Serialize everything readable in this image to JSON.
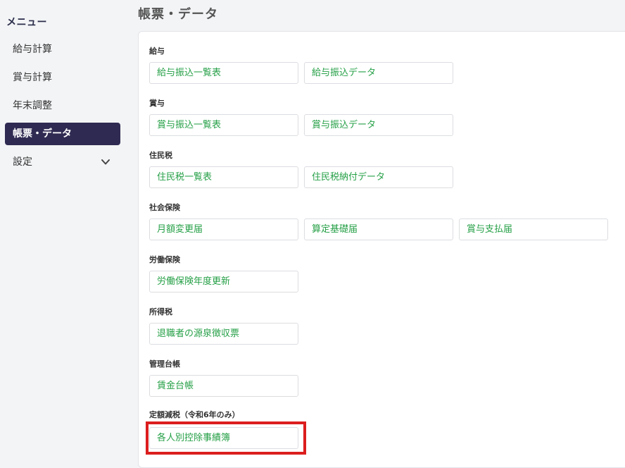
{
  "sidebar": {
    "heading": "メニュー",
    "items": [
      {
        "label": "給与計算"
      },
      {
        "label": "賞与計算"
      },
      {
        "label": "年末調整"
      },
      {
        "label": "帳票・データ"
      },
      {
        "label": "設定"
      }
    ],
    "active_item": "帳票・データ"
  },
  "header": {
    "title": "帳票・データ"
  },
  "sections": [
    {
      "label": "給与",
      "buttons": [
        "給与振込一覧表",
        "給与振込データ"
      ]
    },
    {
      "label": "賞与",
      "buttons": [
        "賞与振込一覧表",
        "賞与振込データ"
      ]
    },
    {
      "label": "住民税",
      "buttons": [
        "住民税一覧表",
        "住民税納付データ"
      ]
    },
    {
      "label": "社会保険",
      "buttons": [
        "月額変更届",
        "算定基礎届",
        "賞与支払届"
      ]
    },
    {
      "label": "労働保険",
      "buttons": [
        "労働保険年度更新"
      ]
    },
    {
      "label": "所得税",
      "buttons": [
        "退職者の源泉徴収票"
      ]
    },
    {
      "label": "管理台帳",
      "buttons": [
        "賃金台帳"
      ]
    },
    {
      "label": "定額減税（令和6年のみ）",
      "buttons": [
        "各人別控除事績簿"
      ]
    }
  ],
  "colors": {
    "sidebar_active_bg": "#2f2a52",
    "button_text": "#26a047",
    "highlight_border": "#dc1e1e"
  },
  "icons": {
    "settings_chevron": "chevron-down-icon"
  }
}
